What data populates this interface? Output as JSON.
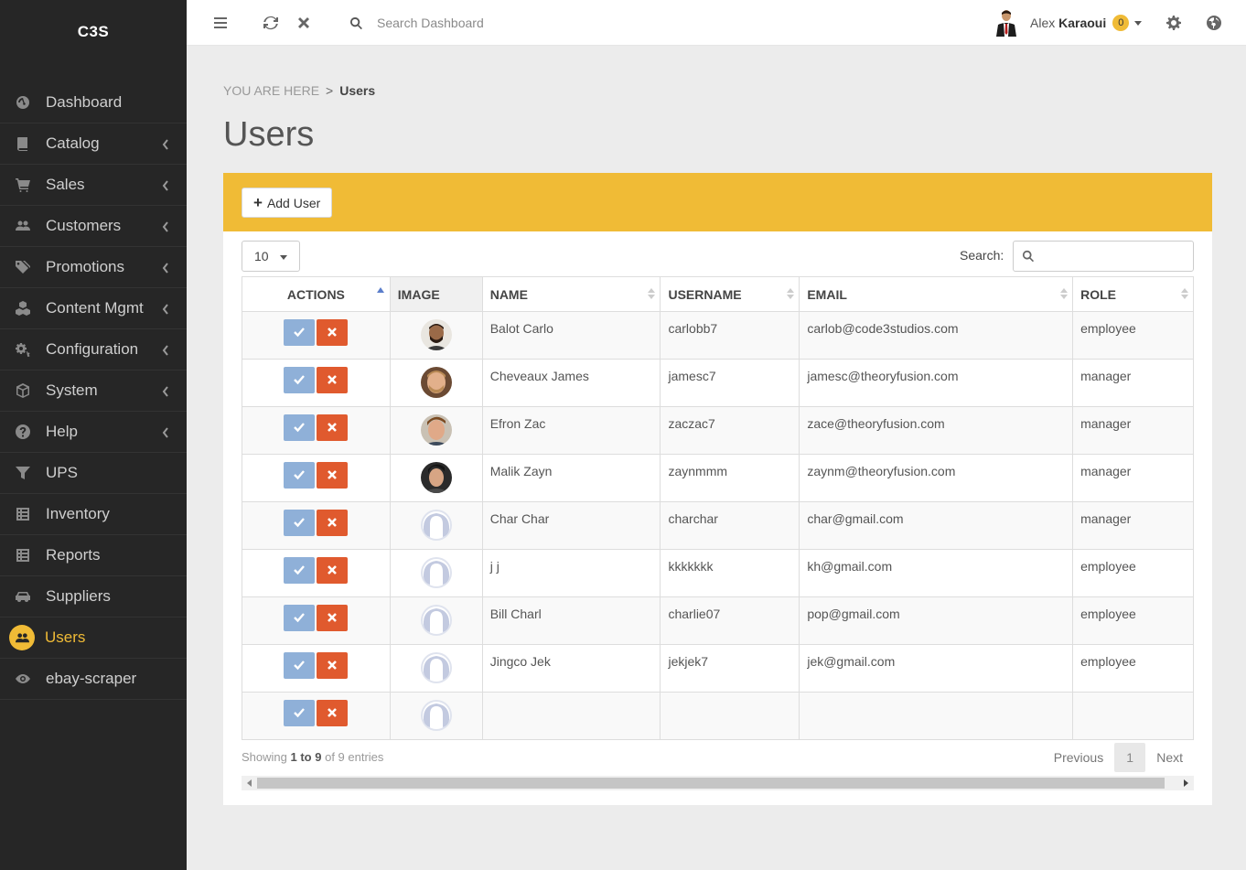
{
  "brand": "C3S",
  "sidebar": {
    "items": [
      {
        "label": "Dashboard",
        "icon": "dashboard-icon",
        "has_children": false
      },
      {
        "label": "Catalog",
        "icon": "book-icon",
        "has_children": true
      },
      {
        "label": "Sales",
        "icon": "cart-icon",
        "has_children": true
      },
      {
        "label": "Customers",
        "icon": "users-icon",
        "has_children": true
      },
      {
        "label": "Promotions",
        "icon": "tags-icon",
        "has_children": true
      },
      {
        "label": "Content Mgmt",
        "icon": "cubes-icon",
        "has_children": true
      },
      {
        "label": "Configuration",
        "icon": "cogs-icon",
        "has_children": true
      },
      {
        "label": "System",
        "icon": "cube-icon",
        "has_children": true
      },
      {
        "label": "Help",
        "icon": "question-icon",
        "has_children": true
      },
      {
        "label": "UPS",
        "icon": "filter-icon",
        "has_children": false
      },
      {
        "label": "Inventory",
        "icon": "list-icon",
        "has_children": false
      },
      {
        "label": "Reports",
        "icon": "list-icon",
        "has_children": false
      },
      {
        "label": "Suppliers",
        "icon": "car-icon",
        "has_children": false
      },
      {
        "label": "Users",
        "icon": "users-icon",
        "has_children": false,
        "active": true
      },
      {
        "label": "ebay-scraper",
        "icon": "eye-icon",
        "has_children": false
      }
    ]
  },
  "topbar": {
    "search_placeholder": "Search Dashboard",
    "user_first": "Alex",
    "user_last": "Karaoui",
    "notifications": "0"
  },
  "breadcrumb": {
    "prefix": "YOU ARE HERE",
    "separator": ">",
    "current": "Users"
  },
  "page_title": "Users",
  "panel": {
    "add_button": "Add User",
    "page_length": "10",
    "search_label": "Search:"
  },
  "table": {
    "columns": [
      "ACTIONS",
      "IMAGE",
      "NAME",
      "USERNAME",
      "EMAIL",
      "ROLE"
    ],
    "rows": [
      {
        "name": "Balot Carlo",
        "username": "carlobb7",
        "email": "carlob@code3studios.com",
        "role": "employee",
        "avatar": "photo-1"
      },
      {
        "name": "Cheveaux James",
        "username": "jamesc7",
        "email": "jamesc@theoryfusion.com",
        "role": "manager",
        "avatar": "photo-2"
      },
      {
        "name": "Efron Zac",
        "username": "zaczac7",
        "email": "zace@theoryfusion.com",
        "role": "manager",
        "avatar": "photo-3"
      },
      {
        "name": "Malik Zayn",
        "username": "zaynmmm",
        "email": "zaynm@theoryfusion.com",
        "role": "manager",
        "avatar": "photo-4"
      },
      {
        "name": "Char Char",
        "username": "charchar",
        "email": "char@gmail.com",
        "role": "manager",
        "avatar": "placeholder"
      },
      {
        "name": "j j",
        "username": "kkkkkkk",
        "email": "kh@gmail.com",
        "role": "employee",
        "avatar": "placeholder"
      },
      {
        "name": "Bill Charl",
        "username": "charlie07",
        "email": "pop@gmail.com",
        "role": "employee",
        "avatar": "placeholder"
      },
      {
        "name": "Jingco Jek",
        "username": "jekjek7",
        "email": "jek@gmail.com",
        "role": "employee",
        "avatar": "placeholder"
      },
      {
        "name": "",
        "username": "",
        "email": "",
        "role": "",
        "avatar": "placeholder"
      }
    ]
  },
  "footer": {
    "showing_prefix": "Showing",
    "showing_range": "1 to 9",
    "showing_suffix": "of 9 entries",
    "previous": "Previous",
    "page": "1",
    "next": "Next"
  },
  "colors": {
    "sidebar_bg": "#262626",
    "accent": "#f0bb36",
    "approve": "#8fb0d8",
    "delete": "#e05a2e"
  }
}
